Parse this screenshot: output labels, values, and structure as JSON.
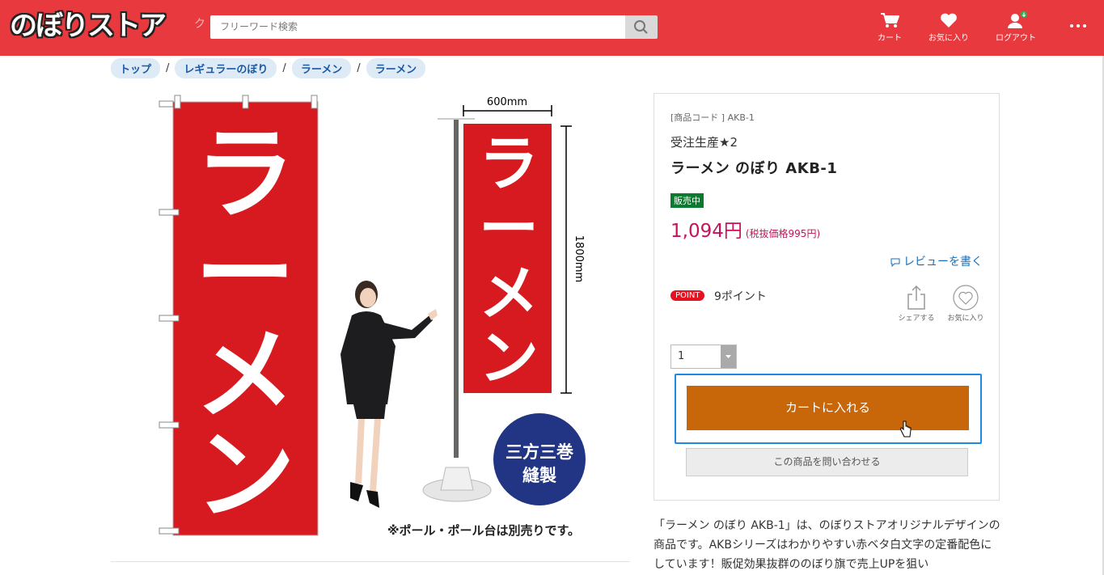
{
  "header": {
    "logo": "のぼりストア",
    "search_placeholder": "フリーワード検索",
    "cart_label": "カート",
    "favorites_label": "お気に入り",
    "logout_label": "ログアウト",
    "accent_color": "#e8393f"
  },
  "breadcrumb": {
    "items": [
      "トップ",
      "レギュラーのぼり",
      "ラーメン",
      "ラーメン"
    ],
    "separator": "/"
  },
  "image": {
    "flag_text": "ラーメン",
    "width_label": "600mm",
    "height_label": "1800mm",
    "badge_line1": "三方三巻",
    "badge_line2": "縫製",
    "note": "※ポール・ポール台は別売りです。"
  },
  "product": {
    "code": "[商品コード ] AKB-1",
    "subtitle": "受注生産★2",
    "title": "ラーメン のぼり AKB-1",
    "status": "販売中",
    "price": "1,094円",
    "price_ex_tax": "(税抜価格995円)",
    "review_link": "レビューを書く",
    "point_badge": "POINT",
    "points": "9ポイント",
    "share_label": "シェアする",
    "fav_label": "お気に入り",
    "quantity": "1",
    "cart_button": "カートに入れる",
    "inquiry_button": "この商品を問い合わせる"
  },
  "description": "「ラーメン のぼり AKB-1」は、のぼりストアオリジナルデザインの商品です。AKBシリーズはわかりやすい赤ベタ白文字の定番配色にしています！販促効果抜群ののぼり旗で売上UPを狙い"
}
